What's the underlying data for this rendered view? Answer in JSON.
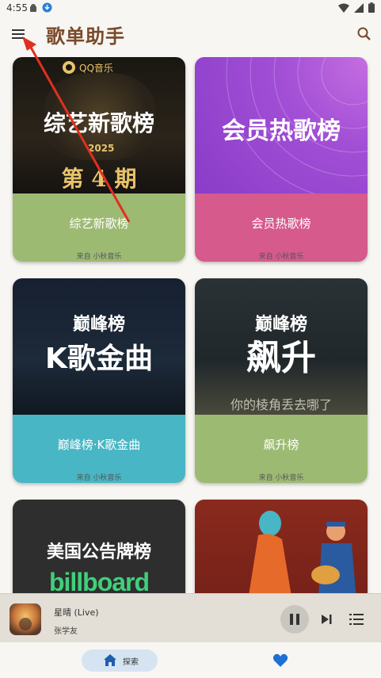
{
  "status_bar": {
    "time": "4:55"
  },
  "app_bar": {
    "title": "歌单助手"
  },
  "playlists": [
    {
      "cover_title": "综艺新歌榜",
      "brand": "QQ音乐",
      "cover_badge": "2025",
      "cover_sub": "第 4 期",
      "label": "综艺新歌榜",
      "source": "来自 小秋音乐",
      "band_color": "#9dba73"
    },
    {
      "cover_title": "会员热歌榜",
      "label": "会员热歌榜",
      "source": "来自 小秋音乐",
      "band_color": "#d65a8c"
    },
    {
      "cover_brand": "巅峰榜",
      "cover_title": "K歌金曲",
      "label": "巅峰榜·K歌金曲",
      "source": "来自 小秋音乐",
      "band_color": "#48b6c4"
    },
    {
      "cover_brand": "巅峰榜",
      "cover_title": "飙升",
      "cover_sub": "你的棱角丢去哪了",
      "label": "飙升榜",
      "source": "来自 小秋音乐",
      "band_color": "#9dba73"
    },
    {
      "cover_title": "美国公告牌榜",
      "cover_logo": "billboard"
    },
    {
      "cover_title": ""
    }
  ],
  "player": {
    "song": "星晴 (Live)",
    "artist": "张学友"
  },
  "bottom_nav": {
    "explore_label": "探索"
  }
}
